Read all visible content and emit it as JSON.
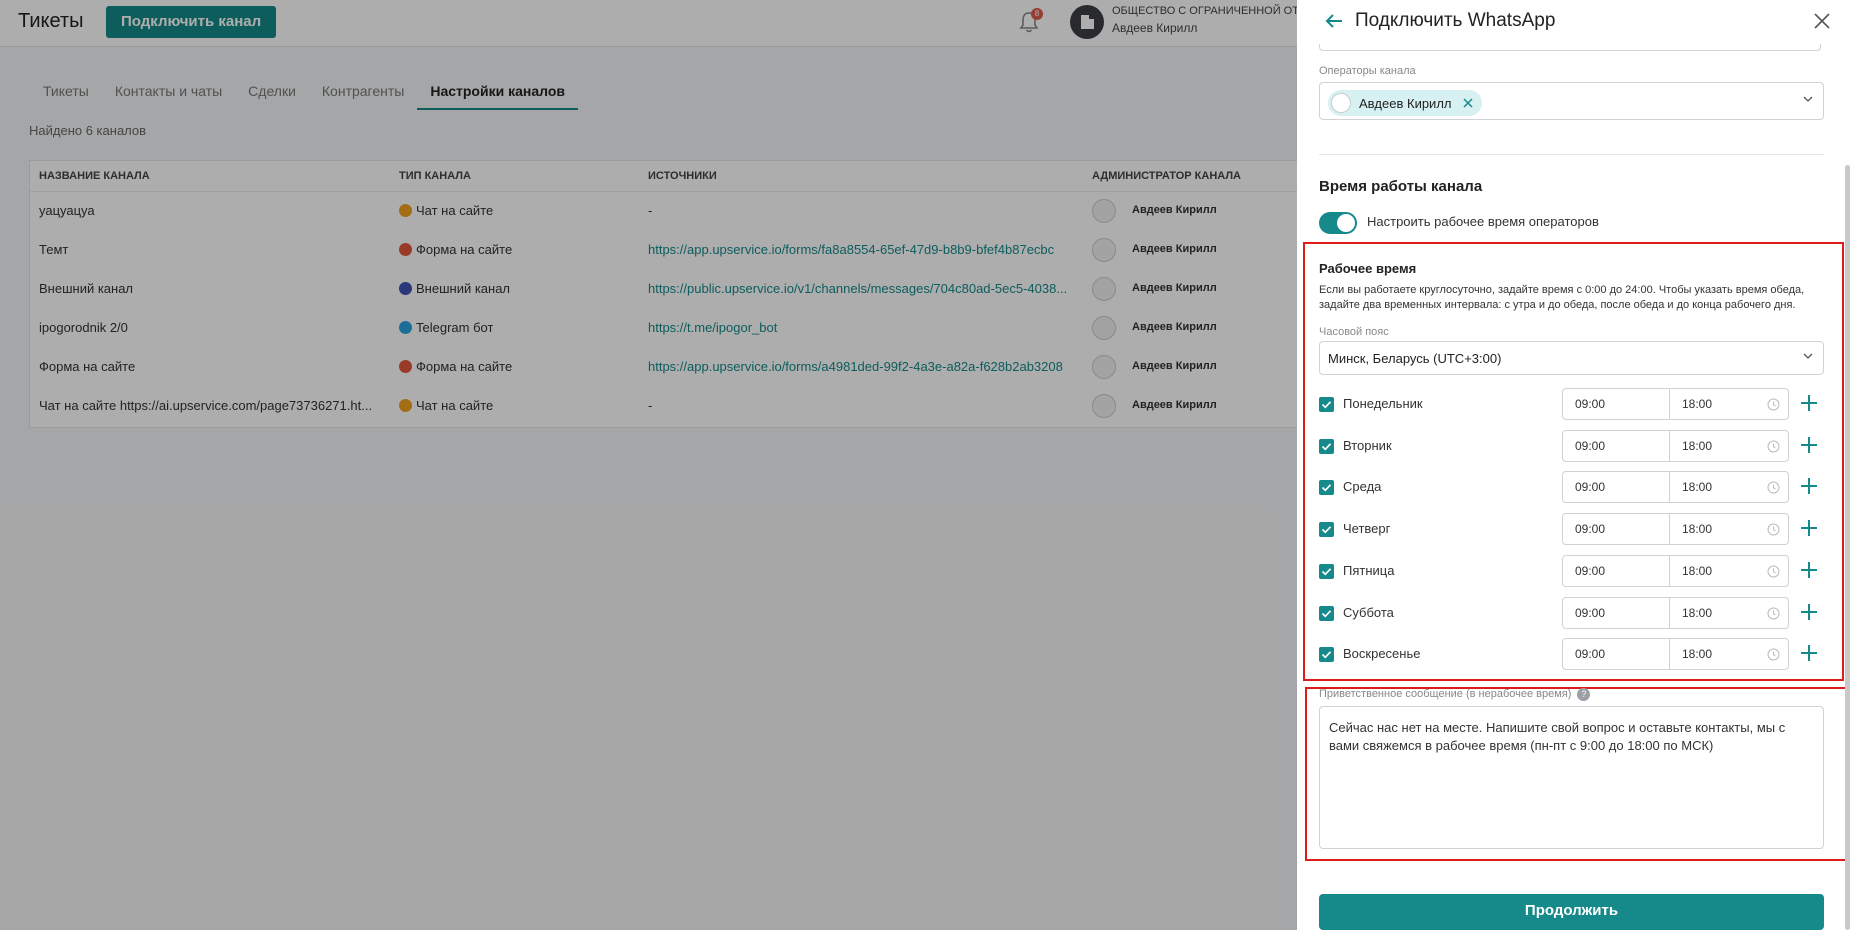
{
  "app": {
    "title": "Тикеты",
    "connect_button": "Подключить канал"
  },
  "notifications": {
    "count": "8"
  },
  "org": {
    "name": "ОБЩЕСТВО С ОГРАНИЧЕННОЙ ОТВ",
    "user": "Авдеев Кирилл"
  },
  "tabs": [
    {
      "label": "Тикеты"
    },
    {
      "label": "Контакты и чаты"
    },
    {
      "label": "Сделки"
    },
    {
      "label": "Контрагенты"
    },
    {
      "label": "Настройки каналов"
    }
  ],
  "found_text": "Найдено 6 каналов",
  "table": {
    "headers": [
      "НАЗВАНИЕ КАНАЛА",
      "ТИП КАНАЛА",
      "ИСТОЧНИКИ",
      "АДМИНИСТРАТОР КАНАЛА"
    ],
    "rows": [
      {
        "name": "уацуацуа",
        "type": "Чат на сайте",
        "type_color": "#f0a020",
        "source": "-",
        "admin": "Авдеев Кирилл"
      },
      {
        "name": "Темт",
        "type": "Форма на сайте",
        "type_color": "#e0593d",
        "source": "https://app.upservice.io/forms/fa8a8554-65ef-47d9-b8b9-bfef4b87ecbc",
        "admin": "Авдеев Кирилл"
      },
      {
        "name": "Внешний канал",
        "type": "Внешний канал",
        "type_color": "#3f51b5",
        "source": "https://public.upservice.io/v1/channels/messages/704c80ad-5ec5-4038...",
        "admin": "Авдеев Кирилл"
      },
      {
        "name": "ipogorodnik 2/0",
        "type": "Telegram бот",
        "type_color": "#2aa3df",
        "source": "https://t.me/ipogor_bot",
        "admin": "Авдеев Кирилл"
      },
      {
        "name": "Форма на сайте",
        "type": "Форма на сайте",
        "type_color": "#e0593d",
        "source": "https://app.upservice.io/forms/a4981ded-99f2-4a3e-a82a-f628b2ab3208",
        "admin": "Авдеев Кирилл"
      },
      {
        "name": "Чат на сайте https://ai.upservice.com/page73736271.ht...",
        "type": "Чат на сайте",
        "type_color": "#f0a020",
        "source": "-",
        "admin": "Авдеев Кирилл"
      }
    ]
  },
  "drawer": {
    "title": "Подключить WhatsApp",
    "operators_label": "Операторы канала",
    "operator_chip": "Авдеев Кирилл",
    "section_title": "Время работы канала",
    "toggle_label": "Настроить рабочее время операторов",
    "toggle_on": true,
    "work_time_title": "Рабочее время",
    "work_time_hint": "Если вы работаете круглосуточно, задайте время с 0:00 до 24:00. Чтобы указать время обеда, задайте два временных интервала: с утра и до обеда, после обеда и до конца рабочего дня.",
    "timezone_label": "Часовой пояс",
    "timezone_value": "Минск, Беларусь (UTC+3:00)",
    "days": [
      {
        "name": "Понедельник",
        "checked": true,
        "from": "09:00",
        "to": "18:00"
      },
      {
        "name": "Вторник",
        "checked": true,
        "from": "09:00",
        "to": "18:00"
      },
      {
        "name": "Среда",
        "checked": true,
        "from": "09:00",
        "to": "18:00"
      },
      {
        "name": "Четверг",
        "checked": true,
        "from": "09:00",
        "to": "18:00"
      },
      {
        "name": "Пятница",
        "checked": true,
        "from": "09:00",
        "to": "18:00"
      },
      {
        "name": "Суббота",
        "checked": true,
        "from": "09:00",
        "to": "18:00"
      },
      {
        "name": "Воскресенье",
        "checked": true,
        "from": "09:00",
        "to": "18:00"
      }
    ],
    "greeting_label": "Приветственное сообщение (в нерабочее время)",
    "greeting_help": "?",
    "greeting_text": "Сейчас нас нет на месте. Напишите свой вопрос и оставьте контакты, мы с вами свяжемся в рабочее время (пн-пт с 9:00 до 18:00 по МСК)",
    "continue_button": "Продолжить"
  },
  "colors": {
    "accent": "#16898a",
    "highlight": "#e0191b"
  },
  "icons": [
    "bell-icon",
    "building-icon",
    "back-arrow-icon",
    "close-icon",
    "chevron-down-icon",
    "clock-icon",
    "plus-icon",
    "help-icon"
  ]
}
